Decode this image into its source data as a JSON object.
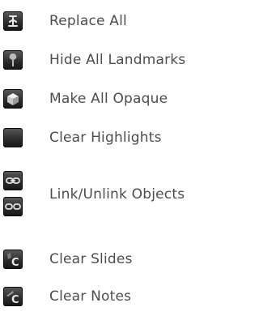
{
  "menu": {
    "items": [
      {
        "id": "replace-all",
        "label": "Replace All",
        "icon": "replace-all-icon"
      },
      {
        "id": "hide-all-landmarks",
        "label": "Hide All Landmarks",
        "icon": "landmark-icon"
      },
      {
        "id": "make-all-opaque",
        "label": "Make All Opaque",
        "icon": "cube-icon"
      },
      {
        "id": "clear-highlights",
        "label": "Clear Highlights",
        "icon": "highlight-box-icon"
      },
      {
        "id": "link-unlink-objects",
        "label": "Link/Unlink Objects",
        "icons": [
          "link-icon",
          "unlink-icon"
        ]
      },
      {
        "id": "clear-slides",
        "label": "Clear Slides",
        "icon": "clear-slides-icon"
      },
      {
        "id": "clear-notes",
        "label": "Clear Notes",
        "icon": "clear-notes-icon"
      }
    ]
  }
}
